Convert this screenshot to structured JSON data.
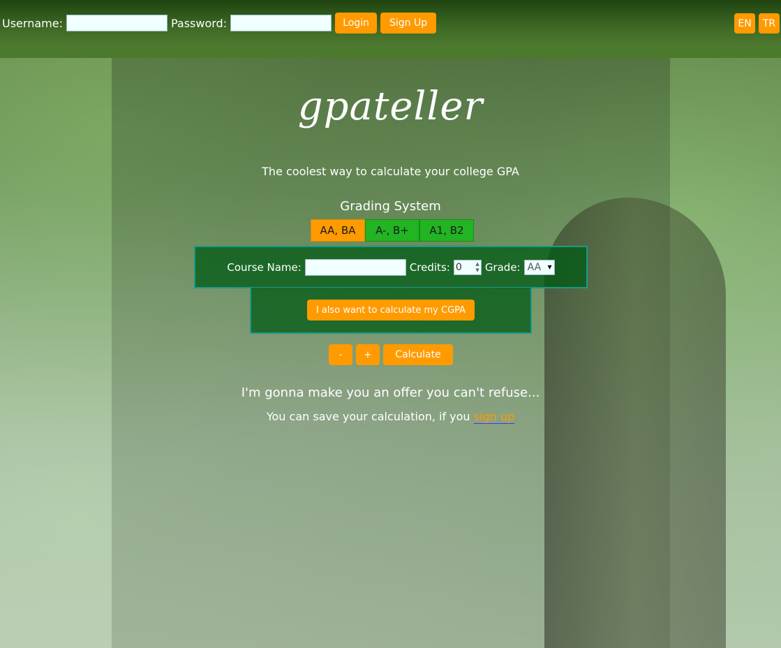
{
  "header": {
    "username_label": "Username:",
    "password_label": "Password:",
    "username_value": "",
    "password_value": "",
    "login_label": "Login",
    "signup_label": "Sign Up",
    "lang_en": "EN",
    "lang_tr": "TR"
  },
  "brand": {
    "logo_text": "gpateller",
    "tagline": "The coolest way to calculate your college GPA"
  },
  "grading": {
    "title": "Grading System",
    "options": [
      "AA, BA",
      "A-, B+",
      "A1, B2"
    ],
    "selected": "AA, BA"
  },
  "course": {
    "name_label": "Course Name:",
    "name_value": "",
    "credits_label": "Credits:",
    "credits_value": "0",
    "grade_label": "Grade:",
    "grade_value": "AA"
  },
  "cgpa_button_label": "I also want to calculate my CGPA",
  "actions": {
    "minus_label": "-",
    "plus_label": "+",
    "calculate_label": "Calculate"
  },
  "offer": {
    "headline": "I'm gonna make you an offer you can't refuse...",
    "text": "You can save your calculation, if you",
    "link_text": "sign up"
  },
  "colors": {
    "accent": "#ff9b00",
    "tab_inactive": "#22b422",
    "panel": "#005a14",
    "header": "#2f5a1a"
  }
}
